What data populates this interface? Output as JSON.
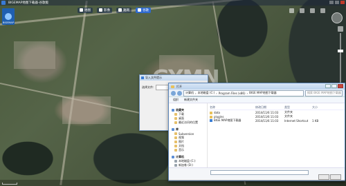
{
  "app": {
    "title": "BIGEMAP地图下载器-谷歌版"
  },
  "toolbar": {
    "items": [
      {
        "label": "地图",
        "active": false
      },
      {
        "label": "影像",
        "active": false
      },
      {
        "label": "路网",
        "active": false
      },
      {
        "label": "谷歌",
        "active": true
      }
    ]
  },
  "logo": {
    "label": "BIGEMAP"
  },
  "watermark": "GYMN",
  "dialog": {
    "title": "导入文件提示",
    "label": "选择文件:",
    "value": "0.1 0.2"
  },
  "explorer": {
    "title": "打开",
    "address": [
      "计算机",
      "本地磁盘 (C:)",
      "Program Files (x86)",
      "BIGE MAP地图下载器"
    ],
    "search_placeholder": "搜索 BIGE MAP地图下载器",
    "toolbar": [
      "组织",
      "新建文件夹"
    ],
    "nav": [
      {
        "label": "收藏夹",
        "head": true
      },
      {
        "label": "下载",
        "indent": true
      },
      {
        "label": "桌面",
        "indent": true
      },
      {
        "label": "最近访问的位置",
        "indent": true
      },
      {
        "label": "库",
        "head": true
      },
      {
        "label": "Subversion",
        "indent": true
      },
      {
        "label": "视频",
        "indent": true
      },
      {
        "label": "图片",
        "indent": true
      },
      {
        "label": "文档",
        "indent": true
      },
      {
        "label": "音乐",
        "indent": true
      },
      {
        "label": "计算机",
        "head": true
      },
      {
        "label": "本地磁盘 (C:)",
        "indent": true
      },
      {
        "label": "新加卷 (D:)",
        "indent": true
      },
      {
        "label": "新加卷 (E:)",
        "indent": true
      },
      {
        "label": "新加卷 (F:)",
        "indent": true
      }
    ],
    "columns": [
      "名称",
      "修改日期",
      "类型",
      "大小"
    ],
    "rows": [
      {
        "name": "data",
        "date": "2014/11/6 11:03",
        "type": "文件夹",
        "size": "",
        "link": false
      },
      {
        "name": "plugins",
        "date": "2014/11/6 11:03",
        "type": "文件夹",
        "size": "",
        "link": false
      },
      {
        "name": "BIGE MAP地图下载器",
        "date": "2014/11/6 11:03",
        "type": "Internet Shortcut",
        "size": "1 KB",
        "link": true
      }
    ]
  }
}
